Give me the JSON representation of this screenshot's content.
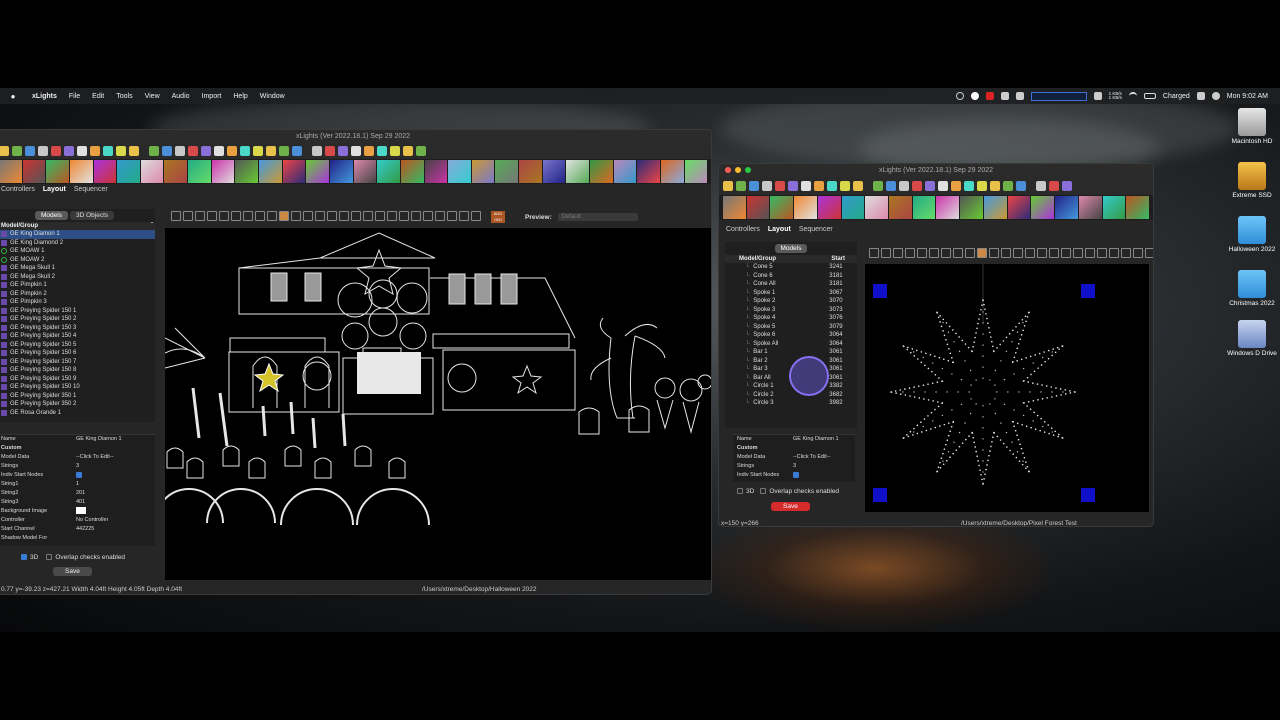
{
  "menubar": {
    "app_name": "xLights",
    "items": [
      "File",
      "Edit",
      "Tools",
      "View",
      "Audio",
      "Import",
      "Help",
      "Window"
    ],
    "net_rate_up": "1 KB/s",
    "net_rate_down": "1 KB/s",
    "battery_status": "Charged",
    "clock": "Mon 9:02 AM"
  },
  "desktop_icons": [
    {
      "label": "Macintosh HD"
    },
    {
      "label": "Extreme SSD"
    },
    {
      "label": "Halloween 2022"
    },
    {
      "label": "Christmas 2022"
    },
    {
      "label": "Windows D Drive"
    }
  ],
  "main_window": {
    "title": "xLights (Ver 2022.18.1) Sep 29 2022",
    "tabs": [
      "Controllers",
      "Layout",
      "Sequencer"
    ],
    "active_tab": "Layout",
    "left_tabs": [
      "Models",
      "3D Objects"
    ],
    "list_header": "Model/Group",
    "models": [
      "GE King Diamon 1",
      "GE King Diamond 2",
      "GE MOAW 1",
      "GE MOAW 2",
      "GE Mega Skull 1",
      "GE Mega Skull 2",
      "GE Pimpkin 1",
      "GE Pimpkin 2",
      "GE Pimpkin 3",
      "GE Preying Spider 150 1",
      "GE Preying Spider 150 2",
      "GE Preying Spider 150 3",
      "GE Preying Spider 150 4",
      "GE Preying Spider 150 5",
      "GE Preying Spider 150 6",
      "GE Preying Spider 150 7",
      "GE Preying Spider 150 8",
      "GE Preying Spider 150 9",
      "GE Preying Spider 150 10",
      "GE Preying Spider 350 1",
      "GE Preying Spider 350 2",
      "GE Rosa Grande 1"
    ],
    "properties": [
      {
        "k": "Name",
        "v": "GE King Diamon 1"
      },
      {
        "k": "Custom",
        "v": "",
        "cat": true
      },
      {
        "k": "Model Data",
        "v": "--Click To Edit--"
      },
      {
        "k": "Strings",
        "v": "3"
      },
      {
        "k": "Indiv Start Nodes",
        "v": "",
        "check": true
      },
      {
        "k": "String1",
        "v": "1"
      },
      {
        "k": "String2",
        "v": "201"
      },
      {
        "k": "String3",
        "v": "401"
      },
      {
        "k": "Background Image",
        "v": "",
        "swatch": true
      },
      {
        "k": "Controller",
        "v": "No Controller"
      },
      {
        "k": "Start Channel",
        "v": "442225"
      },
      {
        "k": "Shadow Model For",
        "v": ""
      }
    ],
    "checkbox_3d": "3D",
    "checkbox_overlap": "Overlap checks enabled",
    "save_label": "Save",
    "preview_label": "Preview:",
    "preview_value": "Default",
    "add_obj_label": "ADD OBJ",
    "status_coords": "0.77 y=-39.23 z=427.21 Width 4.04ft Height 4.05ft Depth 4.04ft",
    "status_path": "/Users/xtreme/Desktop/Halloween 2022"
  },
  "second_window": {
    "title": "xLights (Ver 2022.18.1) Sep 29 2022",
    "tabs": [
      "Controllers",
      "Layout",
      "Sequencer"
    ],
    "active_tab": "Layout",
    "models_tab": "Models",
    "list_header": "Model/Group",
    "list_header_col2": "Start",
    "models": [
      {
        "name": "Cone 5",
        "start": "3241"
      },
      {
        "name": "Cone 6",
        "start": "3181"
      },
      {
        "name": "Cone All",
        "start": "3181"
      },
      {
        "name": "Spoke 1",
        "start": "3067"
      },
      {
        "name": "Spoke 2",
        "start": "3070"
      },
      {
        "name": "Spoke 3",
        "start": "3073"
      },
      {
        "name": "Spoke 4",
        "start": "3076"
      },
      {
        "name": "Spoke 5",
        "start": "3079"
      },
      {
        "name": "Spoke 6",
        "start": "3064"
      },
      {
        "name": "Spoke All",
        "start": "3064"
      },
      {
        "name": "Bar 1",
        "start": "3061"
      },
      {
        "name": "Bar 2",
        "start": "3061"
      },
      {
        "name": "Bar 3",
        "start": "3061"
      },
      {
        "name": "Bar All",
        "start": "3061"
      },
      {
        "name": "Circle 1",
        "start": "3382"
      },
      {
        "name": "Circle 2",
        "start": "3682"
      },
      {
        "name": "Circle 3",
        "start": "3982"
      }
    ],
    "properties": [
      {
        "k": "Name",
        "v": "GE King Diamon 1"
      },
      {
        "k": "Custom",
        "v": "",
        "cat": true
      },
      {
        "k": "Model Data",
        "v": "--Click To Edit--"
      },
      {
        "k": "Strings",
        "v": "3"
      },
      {
        "k": "Indiv Start Nodes",
        "v": "",
        "check": true
      }
    ],
    "checkbox_3d": "3D",
    "checkbox_overlap": "Overlap checks enabled",
    "save_label": "Save",
    "status_coords": "x=150 y=266",
    "status_path": "/Users/xtreme/Desktop/Pixel Forest Test"
  },
  "colors": {
    "accent_blue": "#2d4f86",
    "save_red": "#d52b2b",
    "node_white": "#e8e8e8",
    "marker_blue": "#1010c8"
  }
}
